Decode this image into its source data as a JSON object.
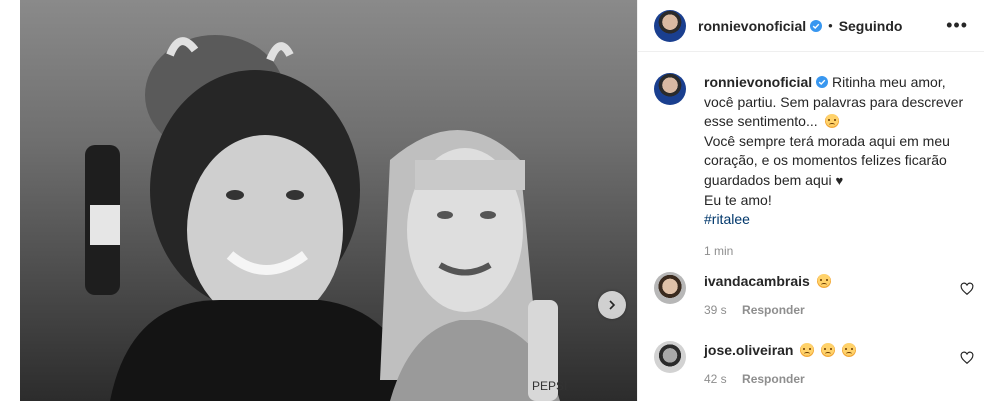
{
  "post": {
    "photo_alt": "",
    "next_button": "next"
  },
  "header": {
    "username": "ronnievonoficial",
    "separator": "•",
    "follow_status": "Seguindo",
    "more": "•••"
  },
  "caption": {
    "username": "ronnievonoficial",
    "lines": [
      "Ritinha meu amor, você partiu. Sem palavras para descrever esse sentimento...",
      "Você sempre terá morada aqui em meu coração, e os momentos felizes ficarão guardados bem aqui",
      "Eu te amo!"
    ],
    "hashtag": "#ritalee",
    "time": "1 min"
  },
  "comments": [
    {
      "username": "ivandacambrais",
      "emoji_count": 1,
      "time": "39 s",
      "reply": "Responder"
    },
    {
      "username": "jose.oliveiran",
      "emoji_count": 3,
      "time": "42 s",
      "reply": "Responder"
    }
  ],
  "colors": {
    "verified": "#3897f0",
    "link": "#00376b",
    "muted": "#8e8e8e"
  }
}
